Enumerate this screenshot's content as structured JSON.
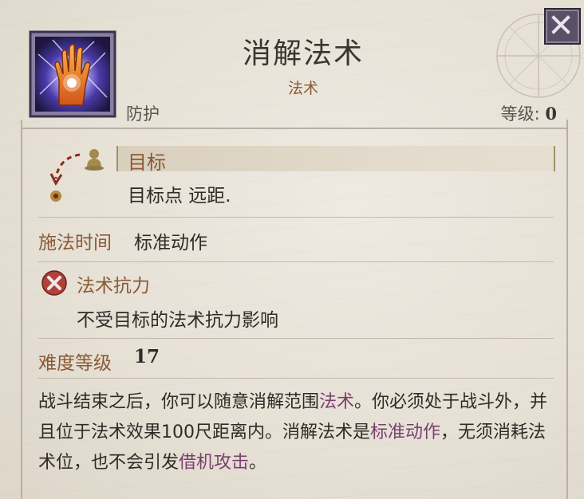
{
  "spell": {
    "title": "消解法术",
    "type": "法术",
    "school": "防护",
    "level_label": "等级: ",
    "level_value": "0"
  },
  "target": {
    "label": "目标",
    "value": "目标点 远距."
  },
  "casting_time": {
    "label": "施法时间",
    "value": "标准动作"
  },
  "spell_resistance": {
    "label": "法术抗力",
    "value": "不受目标的法术抗力影响"
  },
  "dc": {
    "label": "难度等级",
    "value": "17"
  },
  "description": {
    "p1": "战斗结束之后，你可以随意消解范围",
    "link1": "法术",
    "p2": "。你必须处于战斗外，并且位于法术效果100尺距离内。消解法术是",
    "link2": "标准动作",
    "p3": "，无须消耗法术位，也不会引发",
    "link3": "借机攻击",
    "p4": "。"
  },
  "colors": {
    "accent": "#8a5a35",
    "link": "#7a3f6e",
    "text": "#2f2b27",
    "close_bg": "#5a5068"
  },
  "icons": {
    "spell": "glowing-hand-icon",
    "close": "close-icon",
    "target": "target-point-icon",
    "spell_resistance": "no-resistance-icon"
  }
}
